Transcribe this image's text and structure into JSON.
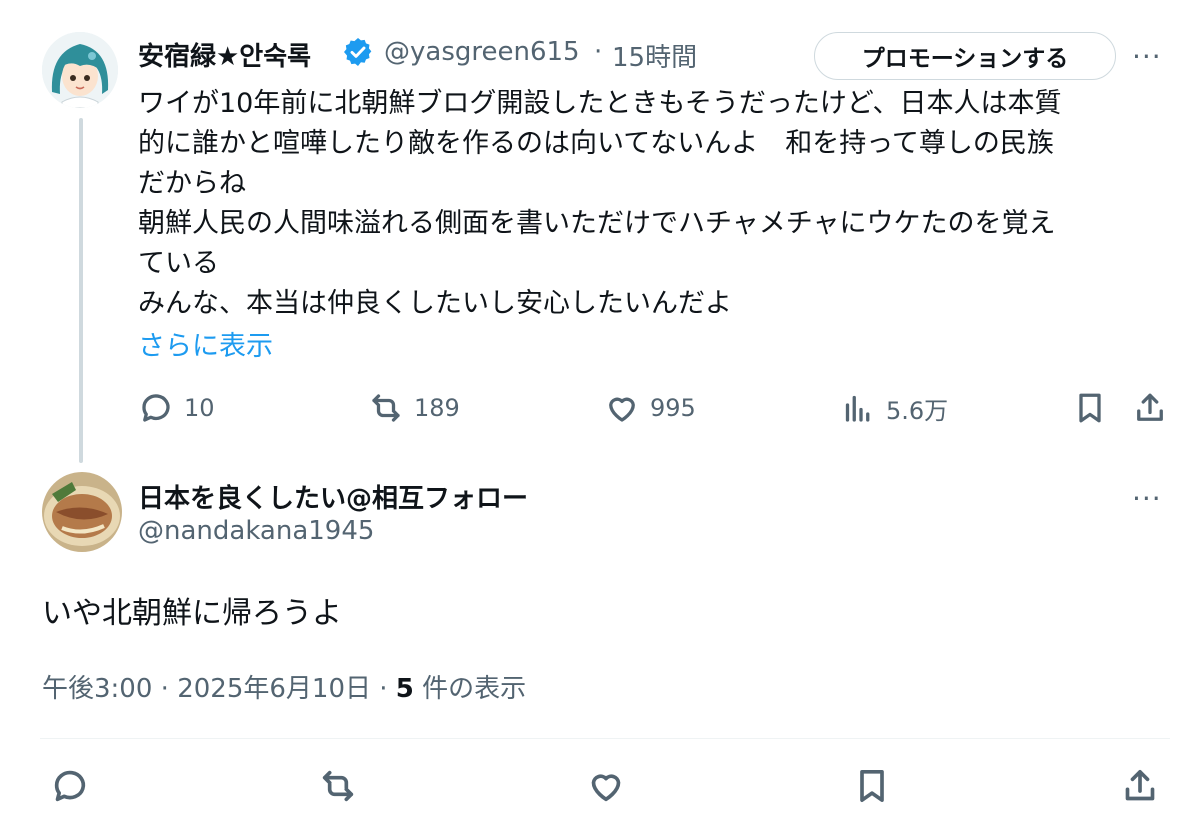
{
  "tweet1": {
    "display_name": "安宿緑★안숙록",
    "handle": "@yasgreen615",
    "separator": "·",
    "time": "15時間",
    "promote_label": "プロモーションする",
    "more_label": "···",
    "lines": [
      "ワイが10年前に北朝鮮ブログ開設したときもそうだったけど、日本人は本質",
      "的に誰かと喧嘩したり敵を作るのは向いてないんよ　和を持って尊しの民族",
      "だからね",
      "朝鮮人民の人間味溢れる側面を書いただけでハチャメチャにウケたのを覚え",
      "ている",
      "みんな、本当は仲良くしたいし安心したいんだよ"
    ],
    "show_more": "さらに表示",
    "replies": "10",
    "reposts": "189",
    "likes": "995",
    "views": "5.6万"
  },
  "tweet2": {
    "display_name": "日本を良くしたい@相互フォロー",
    "handle": "@nandakana1945",
    "more_label": "···",
    "text": "いや北朝鮮に帰ろうよ",
    "time": "午後3:00",
    "date": "2025年6月10日",
    "view_count": "5",
    "view_suffix": "件の表示",
    "sep": "·"
  },
  "colors": {
    "accent": "#1d9bf0",
    "secondary_text": "#536471",
    "border": "#cfd9de"
  },
  "icons": [
    "reply-icon",
    "repost-icon",
    "like-icon",
    "views-icon",
    "bookmark-icon",
    "share-icon",
    "verified-badge-icon",
    "more-icon"
  ]
}
